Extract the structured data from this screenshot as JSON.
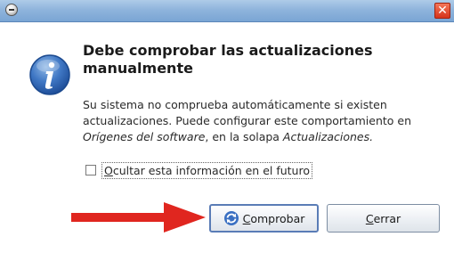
{
  "window": {
    "icon": "update-manager-icon",
    "close_icon": "close-icon",
    "close_symbol": "✕"
  },
  "dialog": {
    "icon": "info-icon",
    "heading": "Debe comprobar las actualizaciones manualmente",
    "message_part1": "Su sistema no comprueba automáticamente si existen actualizaciones. Puede configurar este comportamiento en ",
    "message_em1": "Orígenes del software",
    "message_part2": ", en la solapa ",
    "message_em2": "Actualizaciones.",
    "checkbox": {
      "checked": false,
      "mnemonic": "O",
      "label_rest": "cultar esta información en el futuro"
    }
  },
  "buttons": {
    "check": {
      "icon": "refresh-icon",
      "mnemonic": "C",
      "label_rest": "omprobar"
    },
    "close": {
      "mnemonic": "C",
      "label_rest": "errar"
    }
  },
  "annotation": {
    "arrow": "red-arrow-icon",
    "color": "#e0261f"
  }
}
